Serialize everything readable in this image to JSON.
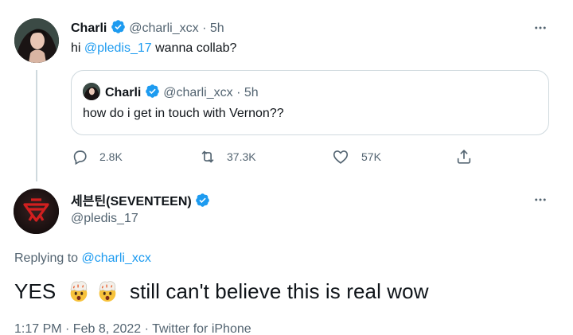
{
  "tweet1": {
    "name": "Charli",
    "handle": "@charli_xcx",
    "time": "· 5h",
    "text_prefix": "hi ",
    "mention": "@pledis_17",
    "text_suffix": " wanna collab?",
    "icon_more": "more-horizontal-icon"
  },
  "quote": {
    "name": "Charli",
    "handle": "@charli_xcx",
    "time": "· 5h",
    "text": "how do i get in touch with Vernon??"
  },
  "actions": {
    "reply_count": "2.8K",
    "retweet_count": "37.3K",
    "like_count": "57K",
    "icons": [
      "reply-icon",
      "retweet-icon",
      "like-icon",
      "share-icon"
    ]
  },
  "tweet2": {
    "name": "세븐틴(SEVENTEEN)",
    "handle": "@pledis_17",
    "replying_prefix": "Replying to ",
    "replying_mention": "@charli_xcx",
    "text_start": "YES",
    "text_end": "still can't believe this is real wow",
    "emoji": "exploding-head-emoji",
    "footer": "1:17 PM · Feb 8, 2022 · Twitter for iPhone"
  },
  "colors": {
    "accent": "#1d9bf0",
    "secondary_text": "#536471",
    "border": "#cfd9de"
  }
}
